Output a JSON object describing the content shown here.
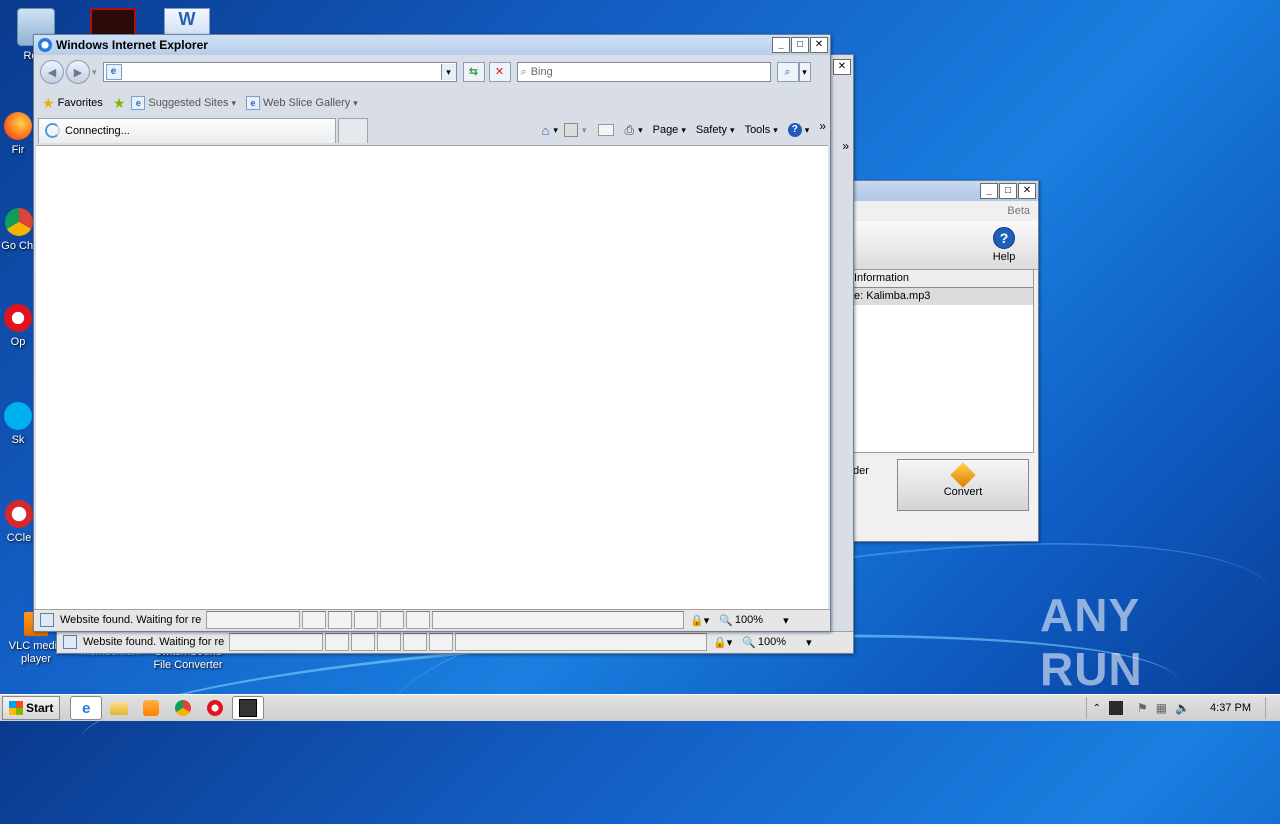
{
  "desktop": {
    "icons": [
      {
        "label": "Recy"
      },
      {
        "label": "Fir"
      },
      {
        "label": "Go Chr"
      },
      {
        "label": "Op"
      },
      {
        "label": "Sk"
      },
      {
        "label": "CCle"
      },
      {
        "label": "VLC media player"
      },
      {
        "label": "member.ram"
      },
      {
        "label": "Switch Sound File Converter"
      }
    ],
    "watermark": "ANY RUN"
  },
  "back_window": {
    "beta": "Beta",
    "help_label": "Help",
    "info_header": "Information",
    "info_row": "e: Kalimba.mp3",
    "side_label": "der",
    "convert_label": "Convert"
  },
  "ie_window": {
    "title": "Windows Internet Explorer",
    "address_value": "",
    "search_placeholder": "Bing",
    "favorites_label": "Favorites",
    "suggested_sites": "Suggested Sites",
    "web_slice_gallery": "Web Slice Gallery",
    "tab_label": "Connecting...",
    "menu": {
      "page": "Page",
      "safety": "Safety",
      "tools": "Tools"
    },
    "status_text": "Website found. Waiting for re",
    "zoom": "100%"
  },
  "ie_window_back_status": {
    "status_text": "Website found. Waiting for re",
    "zoom": "100%"
  },
  "taskbar": {
    "start_label": "Start",
    "clock": "4:37 PM"
  }
}
